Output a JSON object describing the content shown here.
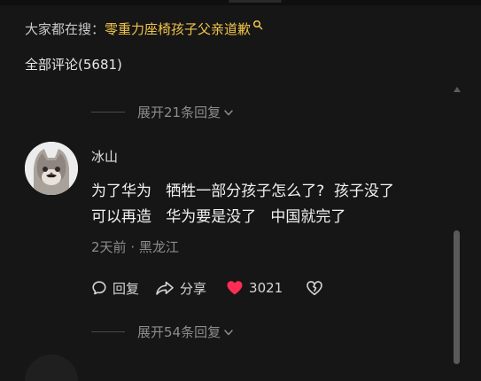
{
  "search_hint": {
    "prefix": "大家都在搜：",
    "keyword": "零重力座椅孩子父亲道歉",
    "icon": "search-icon",
    "keyword_color": "#f0c44a"
  },
  "comments": {
    "title": "全部评论(5681)"
  },
  "expand_above": {
    "label": "展开21条回复",
    "icon": "chevron-down-icon"
  },
  "comment": {
    "username": "冰山",
    "avatar_icon": "cat-avatar-icon",
    "text": "为了华为   牺牲一部分孩子怎么了?  孩子没了\n可以再造   华为要是没了   中国就完了",
    "time": "2天前",
    "separator": "·",
    "location": "黑龙江",
    "actions": {
      "reply_label": "回复",
      "reply_icon": "comment-bubble-icon",
      "share_label": "分享",
      "share_icon": "share-arrow-icon",
      "like_count": "3021",
      "like_icon": "heart-icon",
      "like_color": "#ff2d55",
      "dislike_icon": "broken-heart-icon"
    }
  },
  "expand_below": {
    "label": "展开54条回复",
    "icon": "chevron-down-icon"
  }
}
